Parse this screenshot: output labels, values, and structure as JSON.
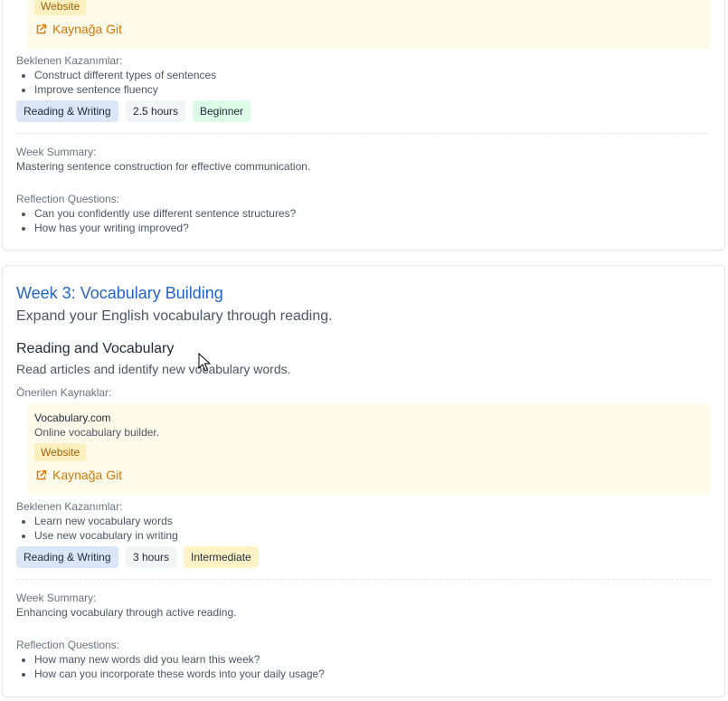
{
  "week2": {
    "resource": {
      "type": "Website",
      "link_label": "Kaynağa Git"
    },
    "outcomes_label": "Beklenen Kazanımlar:",
    "outcomes": [
      "Construct different types of sentences",
      "Improve sentence fluency"
    ],
    "tags": {
      "category": "Reading & Writing",
      "duration": "2.5 hours",
      "level": "Beginner"
    },
    "summary_label": "Week Summary:",
    "summary": "Mastering sentence construction for effective communication.",
    "reflection_label": "Reflection Questions:",
    "reflection": [
      "Can you confidently use different sentence structures?",
      "How has your writing improved?"
    ]
  },
  "week3": {
    "title": "Week 3: Vocabulary Building",
    "subtitle": "Expand your English vocabulary through reading.",
    "activity_title": "Reading and Vocabulary",
    "activity_desc": "Read articles and identify new vocabulary words.",
    "resources_label": "Önerilen Kaynaklar:",
    "resource": {
      "name": "Vocabulary.com",
      "desc": "Online vocabulary builder.",
      "type": "Website",
      "link_label": "Kaynağa Git"
    },
    "outcomes_label": "Beklenen Kazanımlar:",
    "outcomes": [
      "Learn new vocabulary words",
      "Use new vocabulary in writing"
    ],
    "tags": {
      "category": "Reading & Writing",
      "duration": "3 hours",
      "level": "Intermediate"
    },
    "summary_label": "Week Summary:",
    "summary": "Enhancing vocabulary through active reading.",
    "reflection_label": "Reflection Questions:",
    "reflection": [
      "How many new words did you learn this week?",
      "How can you incorporate these words into your daily usage?"
    ]
  }
}
